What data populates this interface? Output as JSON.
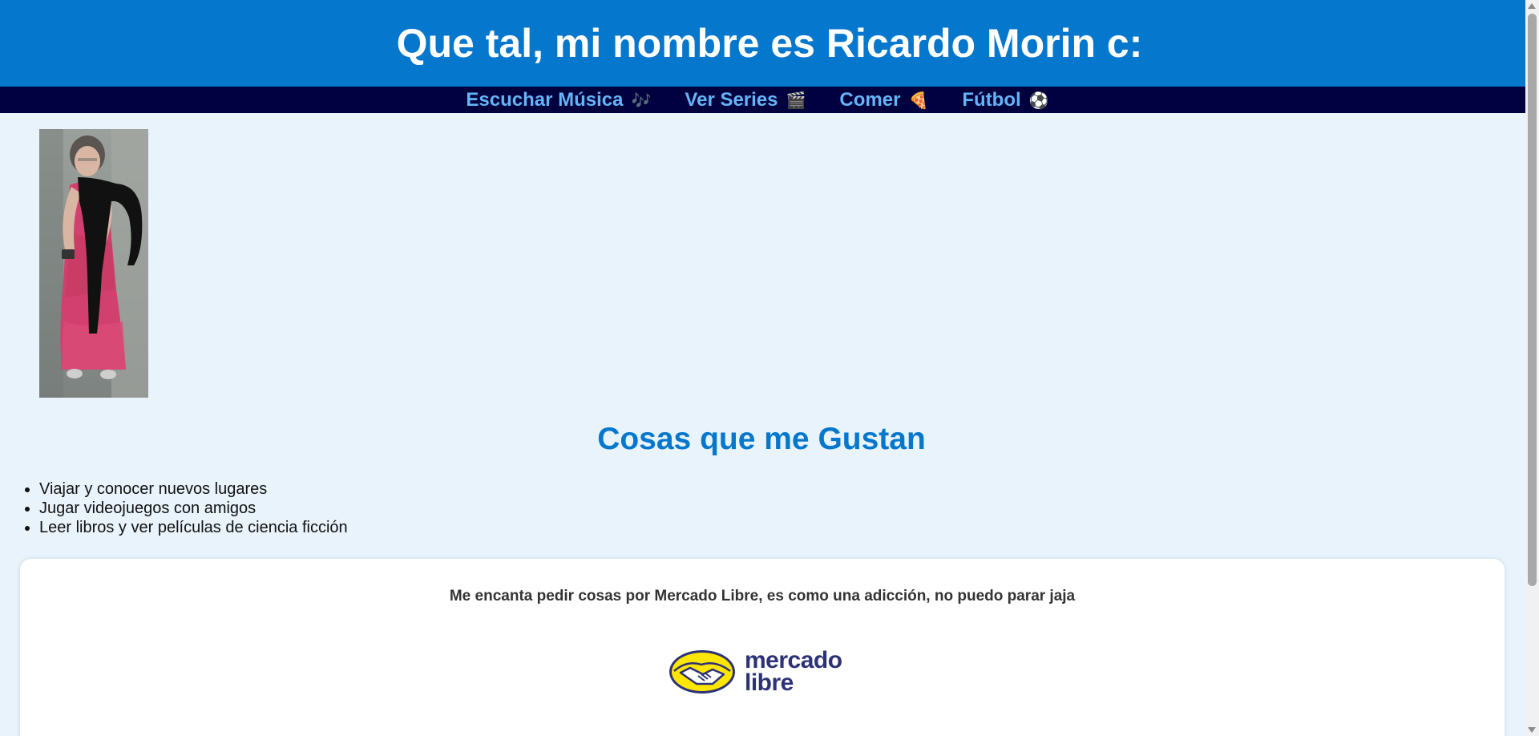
{
  "header": {
    "title": "Que tal, mi nombre es Ricardo Morin c:"
  },
  "nav": {
    "items": [
      {
        "label": "Escuchar Música",
        "emoji": "🎶",
        "icon": "music-icon"
      },
      {
        "label": "Ver Series",
        "emoji": "🎬",
        "icon": "clapperboard-icon"
      },
      {
        "label": "Comer",
        "emoji": "🍕",
        "icon": "pizza-icon"
      },
      {
        "label": "Fútbol",
        "emoji": "⚽",
        "icon": "soccer-ball-icon"
      }
    ]
  },
  "likes": {
    "title": "Cosas que me Gustan",
    "items": [
      "Viajar y conocer nuevos lugares",
      "Jugar videojuegos con amigos",
      "Leer libros y ver películas de ciencia ficción"
    ]
  },
  "card": {
    "text": "Me encanta pedir cosas por Mercado Libre, es como una adicción, no puedo parar jaja",
    "logo_line1": "mercado",
    "logo_line2": "libre"
  },
  "colors": {
    "header_bg": "#0577cd",
    "nav_bg": "#00003f",
    "nav_link": "#64b5f6",
    "page_bg": "#e8f3fb",
    "logo_yellow": "#ffe600",
    "logo_navy": "#2d3277"
  }
}
